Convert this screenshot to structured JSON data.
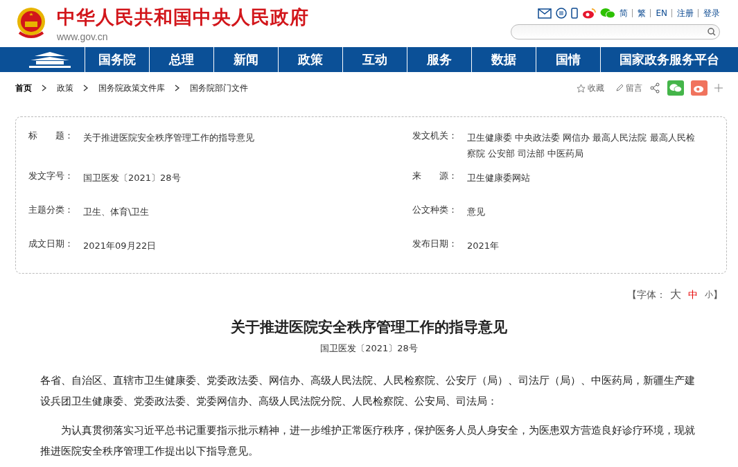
{
  "site": {
    "title": "中华人民共和国中央人民政府",
    "domain": "www.gov.cn"
  },
  "top_links": [
    "简",
    "繁",
    "EN",
    "注册",
    "登录"
  ],
  "nav": [
    "国务院",
    "总理",
    "新闻",
    "政策",
    "互动",
    "服务",
    "数据",
    "国情",
    "国家政务服务平台"
  ],
  "breadcrumb": [
    "首页",
    "政策",
    "国务院政策文件库",
    "国务院部门文件"
  ],
  "share": {
    "favorite": "收藏",
    "comment": "留言"
  },
  "info": [
    {
      "label": "标　　题：",
      "value": "关于推进医院安全秩序管理工作的指导意见"
    },
    {
      "label": "发文机关：",
      "value": "卫生健康委  中央政法委  网信办  最高人民法院  最高人民检察院  公安部  司法部  中医药局"
    },
    {
      "label": "发文字号：",
      "value": "国卫医发〔2021〕28号"
    },
    {
      "label": "来　　源：",
      "value": "卫生健康委网站"
    },
    {
      "label": "主题分类：",
      "value": "卫生、体育\\卫生"
    },
    {
      "label": "公文种类：",
      "value": "意见"
    },
    {
      "label": "成文日期：",
      "value": "2021年09月22日"
    },
    {
      "label": "发布日期：",
      "value": "2021年"
    }
  ],
  "font_size": {
    "open": "【字体：",
    "close": "】",
    "options": [
      {
        "label": "大",
        "selected": false
      },
      {
        "label": "中",
        "selected": true
      },
      {
        "label": "小",
        "selected": false
      }
    ]
  },
  "article": {
    "title": "关于推进医院安全秩序管理工作的指导意见",
    "doc_number": "国卫医发〔2021〕28号",
    "paragraphs": [
      {
        "kind": "salutation",
        "text": "各省、自治区、直辖市卫生健康委、党委政法委、网信办、高级人民法院、人民检察院、公安厅（局）、司法厅（局）、中医药局，新疆生产建设兵团卫生健康委、党委政法委、党委网信办、高级人民法院分院、人民检察院、公安局、司法局："
      },
      {
        "kind": "body",
        "text": "为认真贯彻落实习近平总书记重要指示批示精神，进一步维护正常医疗秩序，保护医务人员人身安全，为医患双方营造良好诊疗环境，现就推进医院安全秩序管理工作提出以下指导意见。"
      }
    ]
  }
}
